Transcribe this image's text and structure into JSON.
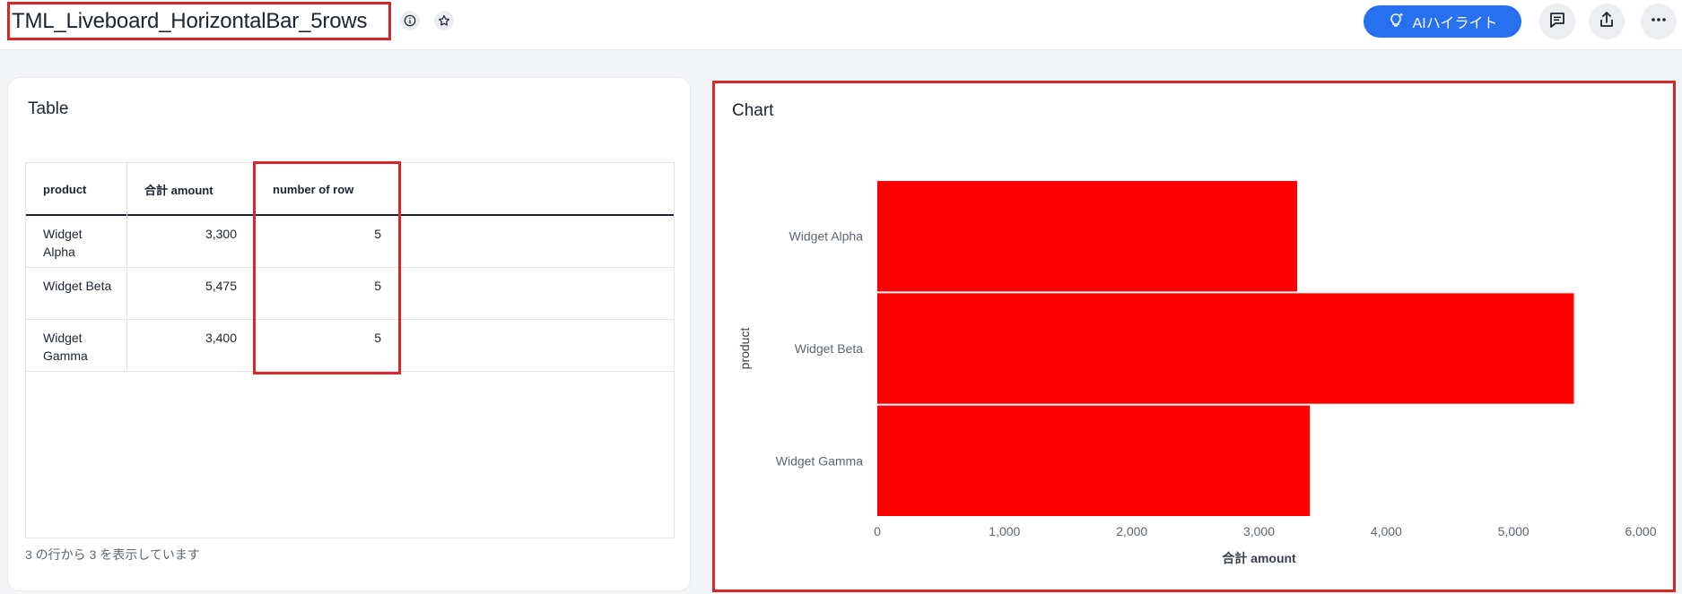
{
  "header": {
    "title": "TML_Liveboard_HorizontalBar_5rows",
    "ai_button_label": "AIハイライト",
    "icons": [
      "info-icon",
      "star-icon",
      "sparkle-bulb-icon",
      "comment-icon",
      "share-icon",
      "more-icon"
    ]
  },
  "colors": {
    "accent": "#2770ef",
    "bar": "#ff0000",
    "highlight_border": "#d62828"
  },
  "table_card": {
    "title": "Table",
    "columns": [
      "product",
      "合計 amount",
      "number of row"
    ],
    "rows": [
      {
        "product": "Widget Alpha",
        "amount": "3,300",
        "count": "5"
      },
      {
        "product": "Widget Beta",
        "amount": "5,475",
        "count": "5"
      },
      {
        "product": "Widget Gamma",
        "amount": "3,400",
        "count": "5"
      }
    ],
    "footer": "3 の行から 3 を表示しています"
  },
  "chart_card": {
    "title": "Chart"
  },
  "chart_data": {
    "type": "bar",
    "orientation": "horizontal",
    "categories": [
      "Widget Alpha",
      "Widget Beta",
      "Widget Gamma"
    ],
    "values": [
      3300,
      5475,
      3400
    ],
    "xlabel": "合計 amount",
    "ylabel": "product",
    "xlim": [
      0,
      6000
    ],
    "xticks": [
      0,
      1000,
      2000,
      3000,
      4000,
      5000,
      6000
    ],
    "xtick_labels": [
      "0",
      "1,000",
      "2,000",
      "3,000",
      "4,000",
      "5,000",
      "6,000"
    ],
    "grid": false,
    "legend": "none"
  }
}
